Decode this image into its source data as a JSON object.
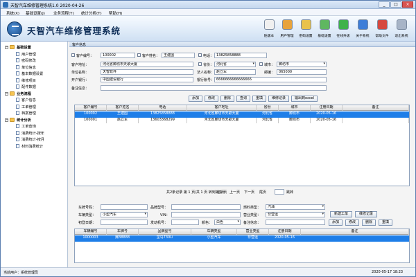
{
  "window": {
    "title": "天智汽车维修管理系统1.0  2020-04-26"
  },
  "menu": [
    "系统(X)",
    "基础设置(J)",
    "业务流程(Y)",
    "统计分析(T)",
    "帮助(H)"
  ],
  "banner": {
    "brand": "天智汽车维修管理系统"
  },
  "toolbar": [
    {
      "label": "贴版本",
      "color": "#f0f0f0",
      "icon": "new-icon"
    },
    {
      "label": "用户管理",
      "color": "#e8a33c",
      "icon": "user-icon"
    },
    {
      "label": "密码设置",
      "color": "#e9c24b",
      "icon": "key-icon"
    },
    {
      "label": "基础设置",
      "color": "#5fb760",
      "icon": "settings-icon"
    },
    {
      "label": "在线升级",
      "color": "#3fb24a",
      "icon": "upgrade-arrow-icon"
    },
    {
      "label": "关于系统",
      "color": "#3d7dd8",
      "icon": "info-icon"
    },
    {
      "label": "帮助文件",
      "color": "#d6493f",
      "icon": "help-icon"
    },
    {
      "label": "退出系统",
      "color": "#a7b4c7",
      "icon": "exit-icon"
    }
  ],
  "sidebar": {
    "groups": [
      {
        "label": "基础设置",
        "items": [
          "用户管理",
          "密码修改",
          "单位信息",
          "基本数据设置",
          "维修项目",
          "配件数据"
        ]
      },
      {
        "label": "业务流程",
        "items": [
          "客户信息",
          "工单管理",
          "档案管理"
        ]
      },
      {
        "label": "统计分析",
        "items": [
          "工单查询",
          "消费统计-按年",
          "消费统计-按月",
          "材料消费统计"
        ]
      }
    ]
  },
  "customer_panel": {
    "title": "客户信息",
    "customer_no_label": "客户编号：",
    "customer_no": "100002",
    "customer_name_label": "客户姓名：",
    "customer_name": "王建国",
    "phone_label": "电话：",
    "phone": "13825858888",
    "address_label": "客户地址：",
    "address": "河北省廊坊市天歌大厦",
    "province_label": "省份：",
    "province": "河北省",
    "city_label": "城市：",
    "city": "廊坊市",
    "company_label": "单位名称：",
    "company": "天智软件",
    "legal_label": "法人名称：",
    "legal": "赵立军",
    "zip_label": "邮编：",
    "zip": "065000",
    "bank_label": "开户银行：",
    "bank": "中国建设银行",
    "account_label": "银行账号：",
    "account": "6666666666666666",
    "remark_label": "备注信息：",
    "remark": ""
  },
  "customer_buttons": [
    "添加",
    "修改",
    "删除",
    "查询",
    "重填",
    "维修记录",
    "输出到excel"
  ],
  "customer_table": {
    "columns": [
      "客户编号",
      "客户姓名",
      "电话",
      "客户地址",
      "省份",
      "城市",
      "注册日期",
      "备注"
    ],
    "rows": [
      [
        "100002",
        "王建国",
        "13825858888",
        "河北省廊坊市天歌大厦",
        "河北省",
        "廊坊市",
        "2020-05-16",
        ""
      ],
      [
        "100001",
        "赵立军",
        "13603368299",
        "河北省廊坊市天歌大厦",
        "河北省",
        "廊坊市",
        "2020-05-16",
        ""
      ]
    ],
    "selected_row": 0
  },
  "pager": {
    "summary": "共2条记录  第 1 页/共 1 页  转到第 1 页",
    "first": "首页",
    "prev": "上一页",
    "next": "下一页",
    "last": "尾页",
    "jump": "跳转"
  },
  "vehicle_form": {
    "plate_label": "车牌号码：",
    "plate": "",
    "model_label": "品牌型号：",
    "model": "",
    "fuel_label": "燃料类型：",
    "fuel": "汽油",
    "type_label": "车辆类型：",
    "type": "小型汽车",
    "vin_label": "VIN：",
    "vin": "",
    "usage_label": "营业类型：",
    "usage": "非营运",
    "regdate_label": "初登日期：",
    "regdate": "",
    "engine_label": "发动机号：",
    "engine": "",
    "color_label": "颜色：",
    "color": "白色",
    "remark_label": "备注信息：",
    "remark": ""
  },
  "vehicle_buttons": {
    "new_order": "新建工单",
    "repair_record": "维修记录",
    "add": "添加",
    "edit": "修改",
    "delete": "删除",
    "reset": "重填"
  },
  "vehicle_table": {
    "columns": [
      "车辆编号",
      "车牌号",
      "品牌型号",
      "车辆类型",
      "营业类型",
      "注册日期",
      "备注"
    ],
    "rows": [
      [
        "1000003",
        "冀B8888",
        "宝马730Li",
        "小型汽车",
        "非营运",
        "2020-05-16",
        ""
      ]
    ],
    "selected_row": 0
  },
  "status": {
    "user": "当前用户：系统管理员",
    "datetime": "2020-05-17 18:23"
  }
}
